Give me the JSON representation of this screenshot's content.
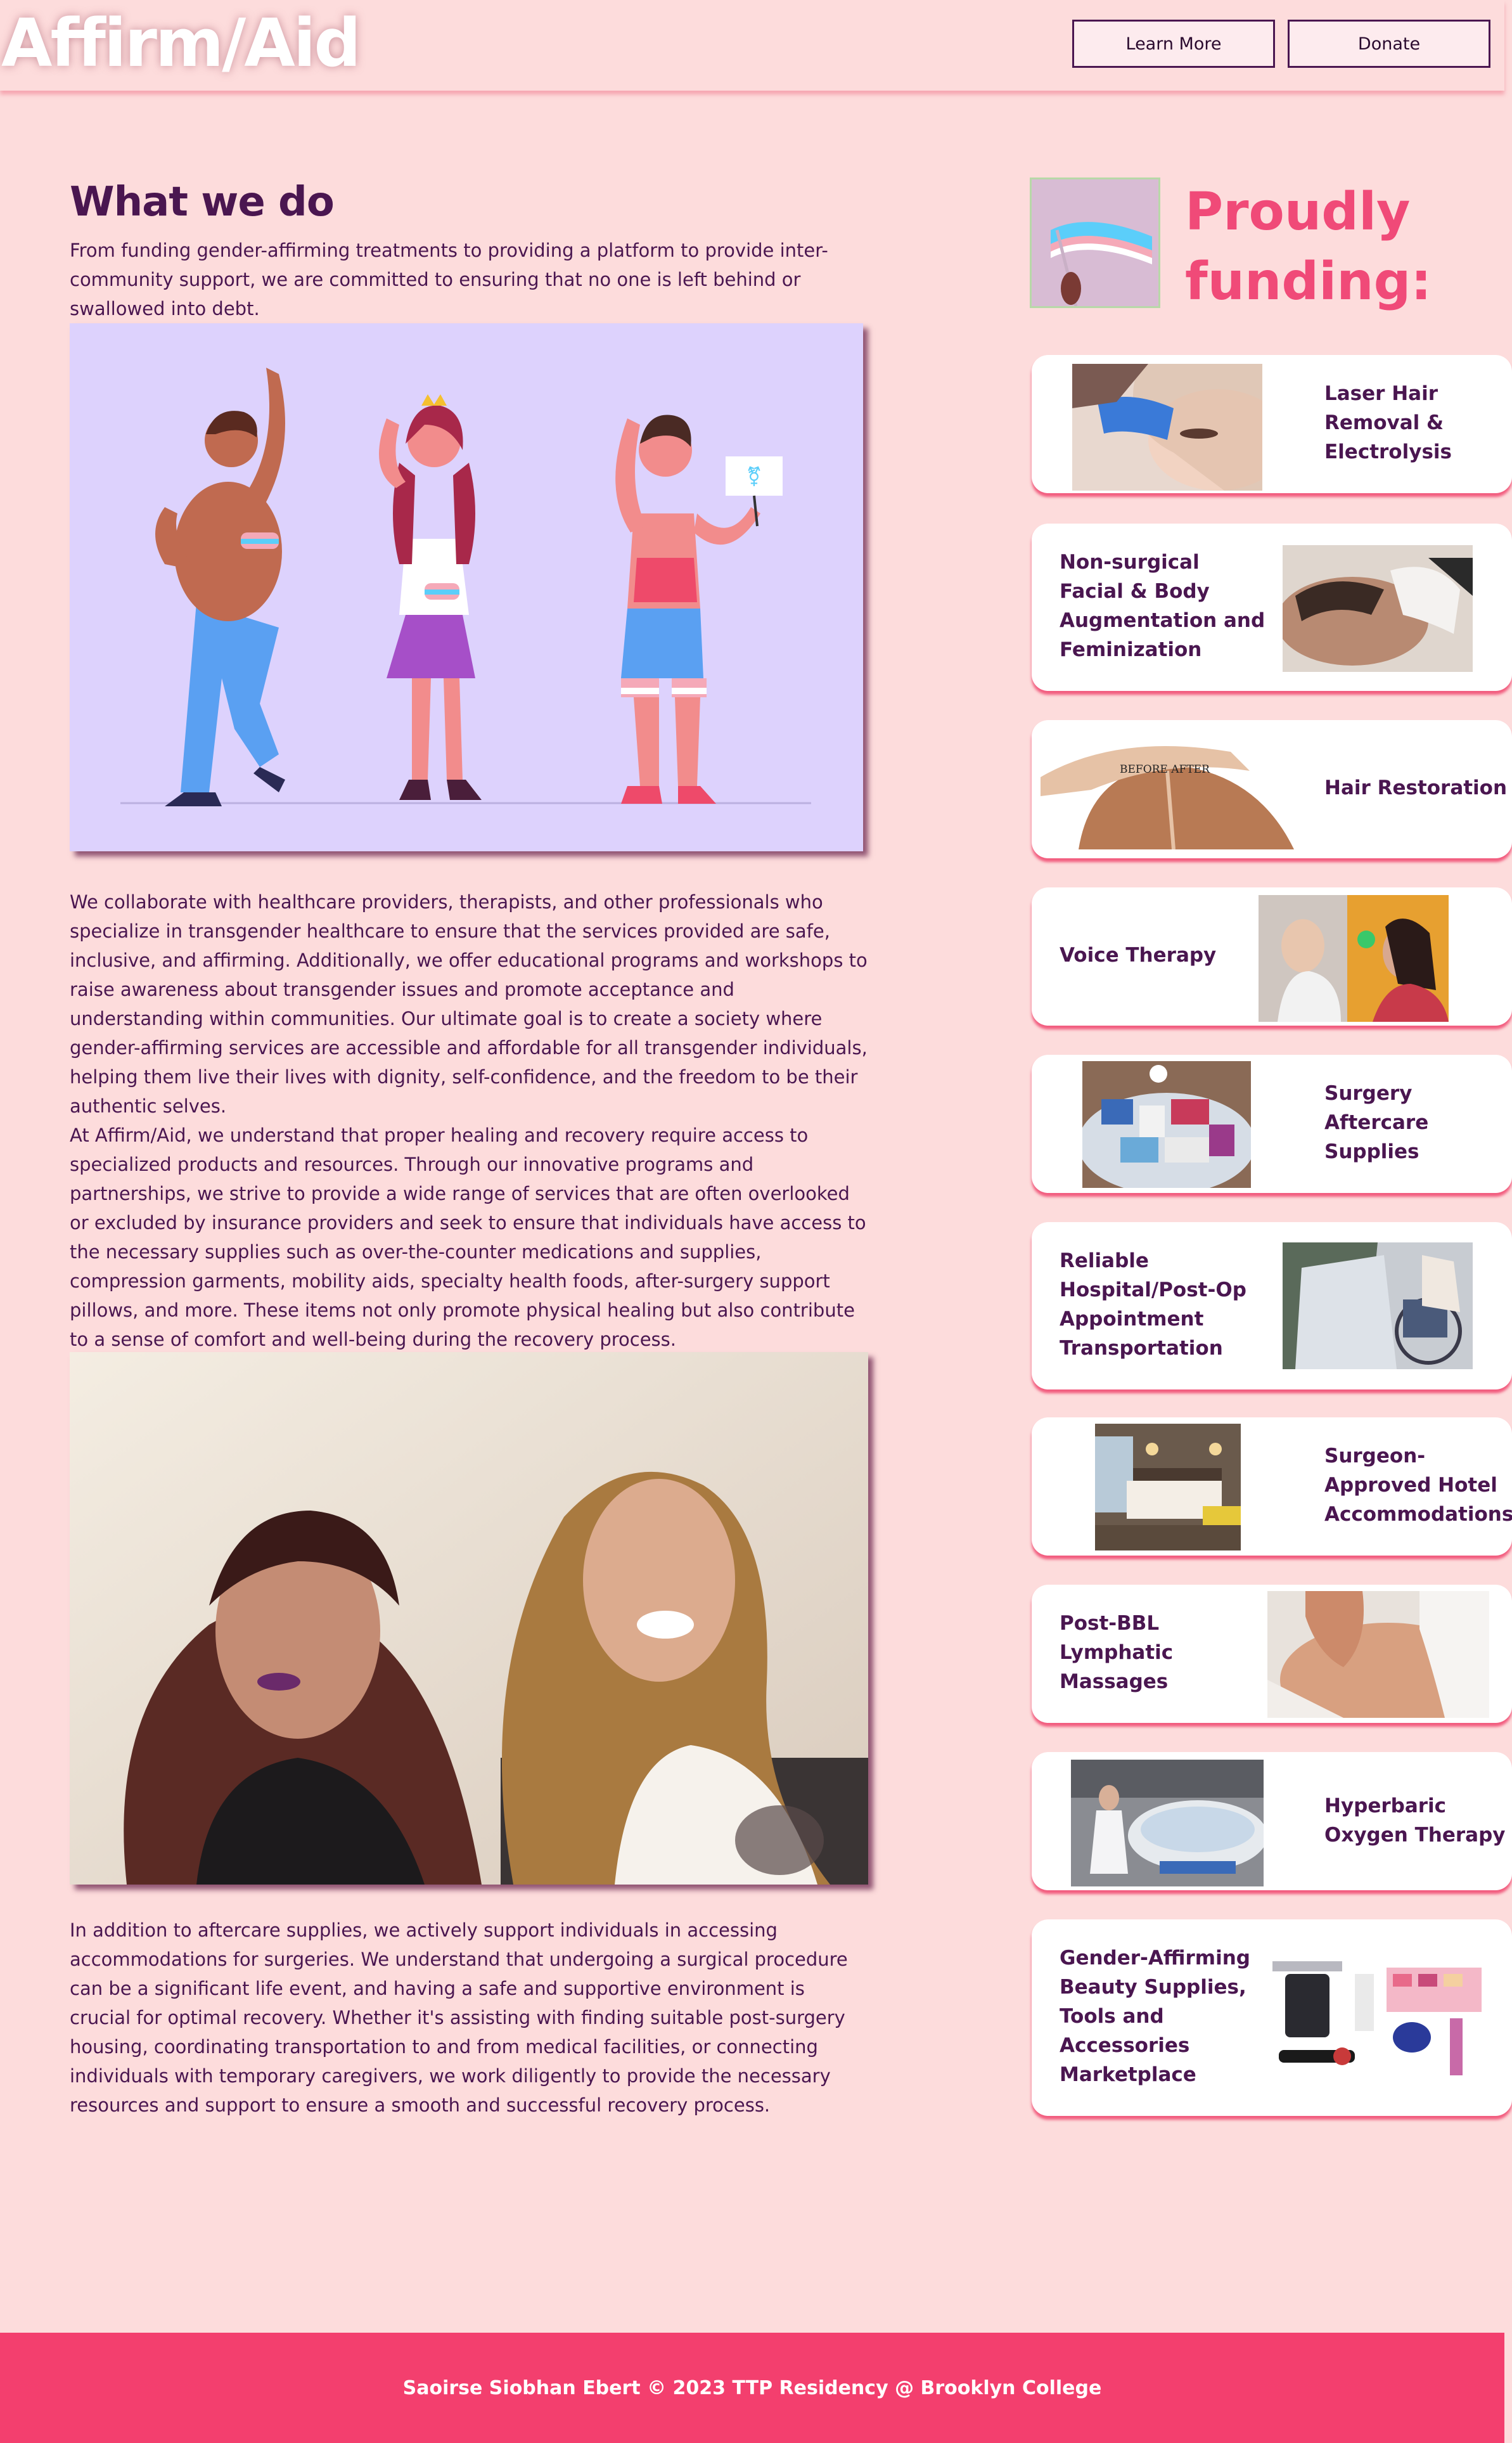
{
  "header": {
    "logo": "Affirm/Aid",
    "learn_more": "Learn More",
    "donate": "Donate"
  },
  "main": {
    "title": "What we do",
    "intro": "From funding gender-affirming treatments to providing a platform to provide inter-community support, we are committed to ensuring that no one is left behind or swallowed into debt.",
    "p1": "We collaborate with healthcare providers, therapists, and other professionals who specialize in transgender healthcare to ensure that the services provided are safe, inclusive, and affirming. Additionally, we offer educational programs and workshops to raise awareness about transgender issues and promote acceptance and understanding within communities. Our ultimate goal is to create a society where gender-affirming services are accessible and affordable for all transgender individuals, helping them live their lives with dignity, self-confidence, and the freedom to be their authentic selves.",
    "p2": "At Affirm/Aid, we understand that proper healing and recovery require access to specialized products and resources. Through our innovative programs and partnerships, we strive to provide a wide range of services that are often overlooked or excluded by insurance providers and seek to ensure that individuals have access to the necessary supplies such as over-the-counter medications and supplies, compression garments, mobility aids, specialty health foods, after-surgery support pillows, and more. These items not only promote physical healing but also contribute to a sense of comfort and well-being during the recovery process.",
    "p3": "In addition to aftercare supplies, we actively support individuals in accessing accommodations for surgeries. We understand that undergoing a surgical procedure can be a significant life event, and having a safe and supportive environment is crucial for optimal recovery. Whether it's assisting with finding suitable post-surgery housing, coordinating transportation to and from medical facilities, or connecting individuals with temporary caregivers, we work diligently to provide the necessary resources and support to ensure a smooth and successful recovery process."
  },
  "sidebar": {
    "title": "Proudly funding:",
    "items": [
      {
        "label": "Laser Hair Removal & Electrolysis"
      },
      {
        "label": "Non-surgical Facial & Body Augmentation and Feminization"
      },
      {
        "label": "Hair Restoration",
        "image_caption": "BEFORE AFTER"
      },
      {
        "label": "Voice Therapy"
      },
      {
        "label": "Surgery Aftercare Supplies"
      },
      {
        "label": "Reliable Hospital/Post-Op Appointment Transportation"
      },
      {
        "label": "Surgeon-Approved Hotel Accommodations"
      },
      {
        "label": "Post-BBL Lymphatic Massages"
      },
      {
        "label": "Hyperbaric Oxygen Therapy"
      },
      {
        "label": "Gender-Affirming Beauty Supplies, Tools and Accessories Marketplace"
      }
    ]
  },
  "footer": {
    "text": "Saoirse Siobhan Ebert © 2023 TTP Residency @ Brooklyn College"
  },
  "colors": {
    "background": "#fddcdc",
    "primary_text": "#4a1650",
    "accent_pink": "#f04a78",
    "footer": "#f33f6e",
    "trans_blue": "#5bcefa",
    "trans_pink": "#f5a9b8"
  }
}
